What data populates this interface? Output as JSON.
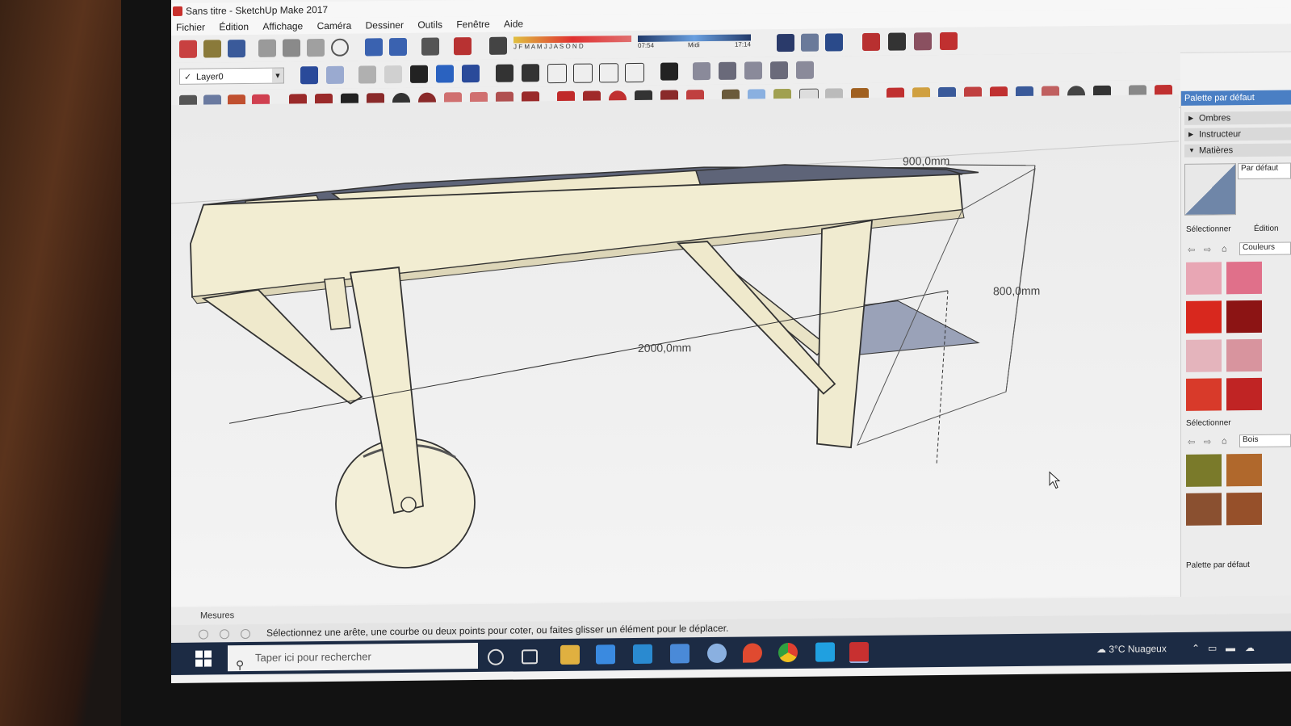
{
  "window": {
    "title": "Sans titre - SketchUp Make 2017"
  },
  "menu": [
    "Fichier",
    "Édition",
    "Affichage",
    "Caméra",
    "Dessiner",
    "Outils",
    "Fenêtre",
    "Aide"
  ],
  "toolbar": {
    "layer_name": "Layer0",
    "months": "J F M A M J J A S O N D",
    "time_start": "07:54",
    "time_mid": "Midi",
    "time_end": "17:14"
  },
  "model": {
    "dim_length": "2000,0mm",
    "dim_width": "900,0mm",
    "dim_height": "800,0mm"
  },
  "panel": {
    "title": "Palette par défaut",
    "sections": [
      "Ombres",
      "Instructeur",
      "Matières"
    ],
    "material_name": "Par défaut",
    "tab_select": "Sélectionner",
    "tab_edit": "Édition",
    "library_top": "Couleurs",
    "select_label_2": "Sélectionner",
    "library_bottom": "Bois",
    "footer": "Palette par défaut",
    "colors_top": [
      "#e8a6b4",
      "#e0708a",
      "#d8281e",
      "#8c1414",
      "#e4b4bc",
      "#d8949e",
      "#d83a2a",
      "#c02424"
    ],
    "colors_bottom": [
      "#7a7a2a",
      "#b0682c",
      "#8a5030",
      "#96502a"
    ]
  },
  "mesures_label": "Mesures",
  "status_text": "Sélectionnez une arête, une courbe ou deux points pour coter, ou faites glisser un élément pour le déplacer.",
  "taskbar": {
    "search_placeholder": "Taper ici pour rechercher",
    "weather": "3°C  Nuageux"
  }
}
